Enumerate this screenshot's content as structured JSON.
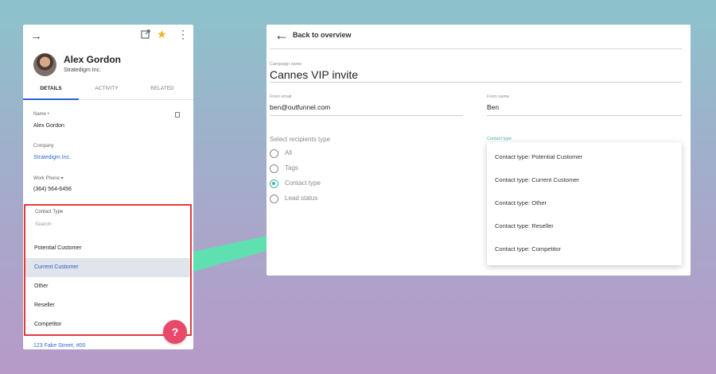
{
  "left_panel": {
    "contact": {
      "name": "Alex Gordon",
      "company": "Stratedigm Inc."
    },
    "tabs": [
      {
        "label": "DETAILS",
        "active": true
      },
      {
        "label": "ACTIVITY",
        "active": false
      },
      {
        "label": "RELATED",
        "active": false
      }
    ],
    "fields": {
      "name_label": "Name •",
      "name_value": "Alex Gordon",
      "company_label": "Company",
      "company_value": "Stratedigm Inc.",
      "phone_label": "Work Phone ▾",
      "phone_value": "(364) 564-6456"
    },
    "contact_type": {
      "label": "Contact Type",
      "search_placeholder": "Search",
      "options": [
        "Potential Customer",
        "Current Customer",
        "Other",
        "Reseller",
        "Competitor"
      ],
      "selected": "Current Customer"
    },
    "help_button": "?",
    "address_peek": "123 Fake Street, #00"
  },
  "right_panel": {
    "back_label": "Back to overview",
    "campaign_name_label": "Campaign name",
    "campaign_name_value": "Cannes VIP invite",
    "from_email_label": "From email",
    "from_email_value": "ben@outfunnel.com",
    "from_name_label": "From name",
    "from_name_value": "Ben",
    "recipients_label": "Select recipients type",
    "recipient_options": [
      {
        "label": "All",
        "checked": false
      },
      {
        "label": "Tags",
        "checked": false
      },
      {
        "label": "Contact type",
        "checked": true
      },
      {
        "label": "Lead status",
        "checked": false
      }
    ],
    "contact_type_label": "Contact type",
    "contact_type_dropdown": [
      "Contact type: Potential Customer",
      "Contact type: Current Customer",
      "Contact type: Other",
      "Contact type: Reseller",
      "Contact type: Competitor"
    ]
  },
  "colors": {
    "accent_teal": "#41b4a8",
    "highlight_red": "#e33b3b",
    "link_blue": "#2f6bd6",
    "connector_green": "#5fe0b0",
    "help_pink": "#e8496a"
  },
  "icons": {
    "back": "arrow-right-icon",
    "external": "external-link-icon",
    "star": "star-icon",
    "more": "more-vertical-icon",
    "copy": "copy-icon",
    "radio": "radio-icon"
  }
}
